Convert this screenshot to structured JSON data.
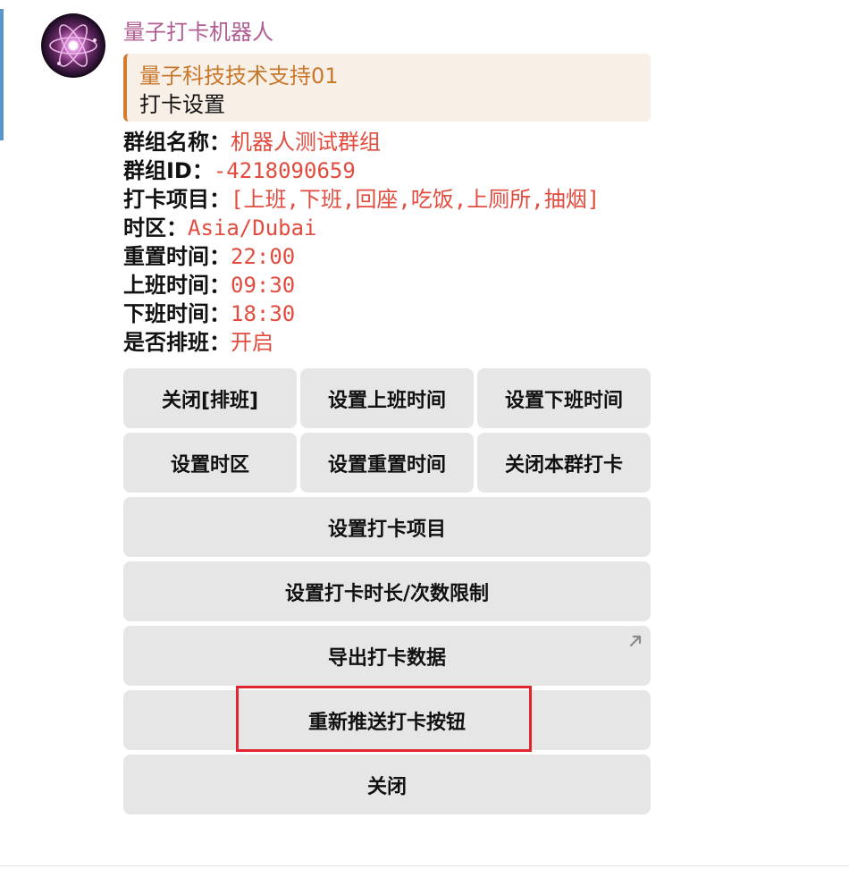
{
  "sender": {
    "name": "量子打卡机器人"
  },
  "reply": {
    "author": "量子科技技术支持01",
    "text": "打卡设置"
  },
  "info": [
    {
      "label": "群组名称：",
      "value": "机器人测试群组"
    },
    {
      "label": "群组ID：",
      "value": "-4218090659"
    },
    {
      "label": "打卡项目：",
      "value": "[上班,下班,回座,吃饭,上厕所,抽烟]"
    },
    {
      "label": "时区：",
      "value": "Asia/Dubai"
    },
    {
      "label": "重置时间：",
      "value": "22:00"
    },
    {
      "label": "上班时间：",
      "value": "09:30"
    },
    {
      "label": "下班时间：",
      "value": "18:30"
    },
    {
      "label": "是否排班：",
      "value": "开启"
    }
  ],
  "keyboard": {
    "close_shift": "关闭[排班]",
    "set_start_time": "设置上班时间",
    "set_end_time": "设置下班时间",
    "set_timezone": "设置时区",
    "set_reset_time": "设置重置时间",
    "close_group_checkin": "关闭本群打卡",
    "set_checkin_items": "设置打卡项目",
    "set_duration_limit": "设置打卡时长/次数限制",
    "export_data": "导出打卡数据",
    "repush_buttons": "重新推送打卡按钮",
    "close": "关闭"
  },
  "colors": {
    "sender": "#b15d93",
    "reply_accent": "#d07d33",
    "value_text": "#e24c3f",
    "button_bg": "#e6e6e6",
    "highlight": "#e0262e"
  },
  "icons": {
    "avatar": "atom-avatar",
    "export": "external-link-arrow-icon"
  }
}
